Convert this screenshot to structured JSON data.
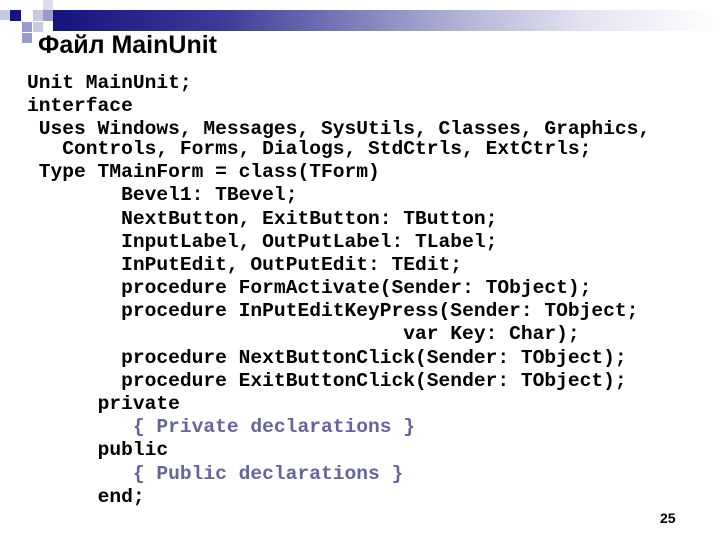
{
  "slide": {
    "title": "Файл MainUnit",
    "page_number": "25",
    "accent_color": "#15157f",
    "comment_color": "#65659a"
  },
  "code": {
    "lines": [
      {
        "indent": "",
        "text": "Unit MainUnit;"
      },
      {
        "indent": "",
        "text": "interface"
      },
      {
        "indent": " ",
        "text": "Uses Windows, Messages, SysUtils, Classes, Graphics,"
      },
      {
        "indent": "   ",
        "text": "Controls, Forms, Dialogs, StdCtrls, ExtCtrls;"
      },
      {
        "indent": " ",
        "text": "Type TMainForm = class(TForm)"
      },
      {
        "indent": "        ",
        "text": "Bevel1: TBevel;"
      },
      {
        "indent": "        ",
        "text": "NextButton, ExitButton: TButton;"
      },
      {
        "indent": "        ",
        "text": "InputLabel, OutPutLabel: TLabel;"
      },
      {
        "indent": "        ",
        "text": "InPutEdit, OutPutEdit: TEdit;"
      },
      {
        "indent": "        ",
        "text": "procedure FormActivate(Sender: TObject);"
      },
      {
        "indent": "        ",
        "text": "procedure InPutEditKeyPress(Sender: TObject;"
      },
      {
        "indent": "                                ",
        "text": "var Key: Char);"
      },
      {
        "indent": "        ",
        "text": "procedure NextButtonClick(Sender: TObject);"
      },
      {
        "indent": "        ",
        "text": "procedure ExitButtonClick(Sender: TObject);"
      },
      {
        "indent": "      ",
        "text": "private"
      },
      {
        "indent": "         ",
        "text": "{ Private declarations }"
      },
      {
        "indent": "      ",
        "text": "public"
      },
      {
        "indent": "         ",
        "text": "{ Public declarations }"
      },
      {
        "indent": "      ",
        "text": "end;"
      }
    ]
  }
}
